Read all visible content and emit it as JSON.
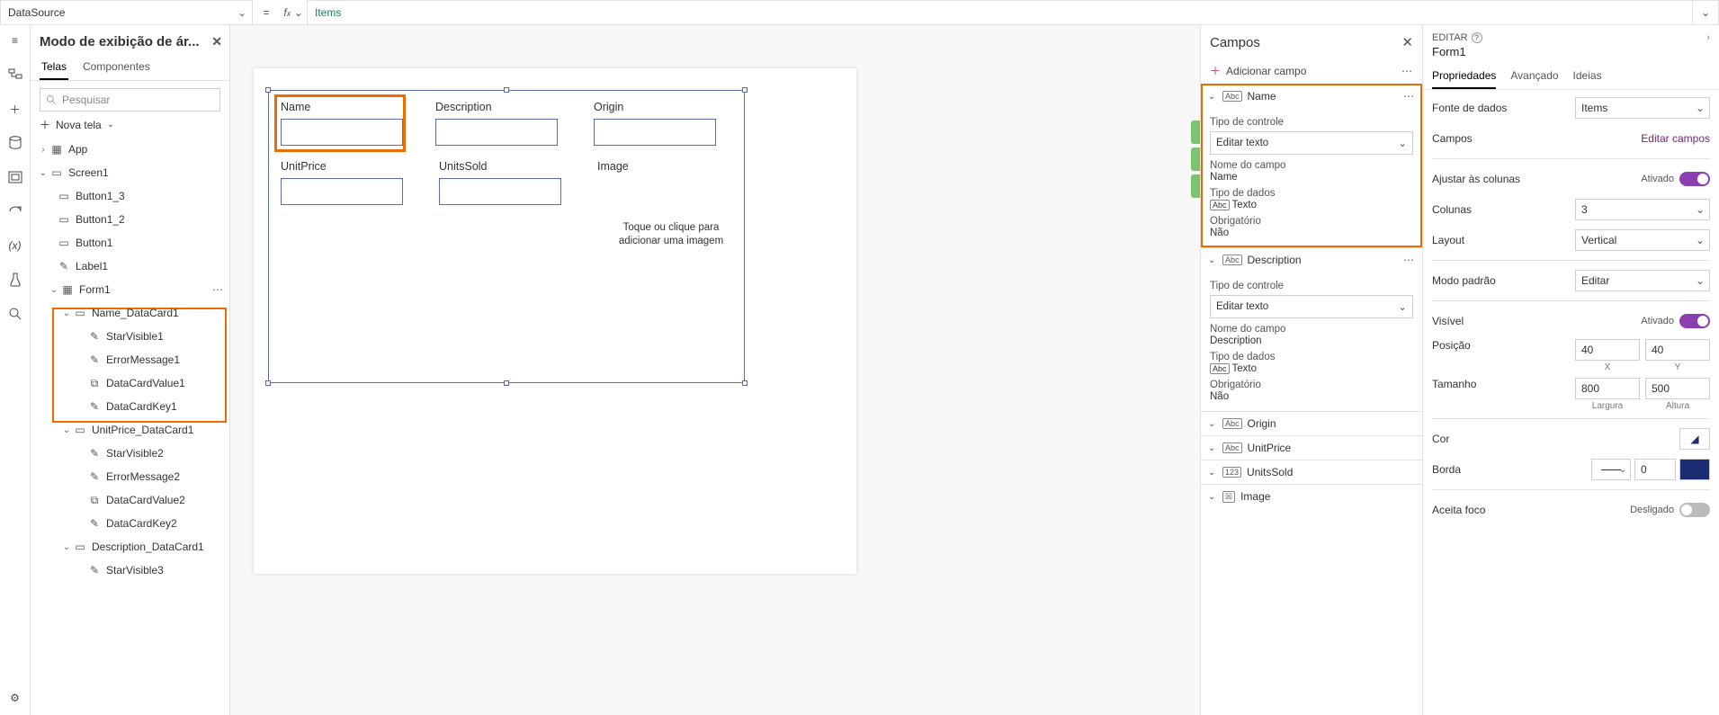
{
  "fx": {
    "property": "DataSource",
    "formula": "Items"
  },
  "tree": {
    "title": "Modo de exibição de ár...",
    "tabs": {
      "screens": "Telas",
      "components": "Componentes"
    },
    "search_placeholder": "Pesquisar",
    "new_screen": "Nova tela",
    "nodes": {
      "app": "App",
      "screen1": "Screen1",
      "button1_3": "Button1_3",
      "button1_2": "Button1_2",
      "button1": "Button1",
      "label1": "Label1",
      "form1": "Form1",
      "name_dc": "Name_DataCard1",
      "starvis1": "StarVisible1",
      "errmsg1": "ErrorMessage1",
      "dcval1": "DataCardValue1",
      "dckey1": "DataCardKey1",
      "unitprice_dc": "UnitPrice_DataCard1",
      "starvis2": "StarVisible2",
      "errmsg2": "ErrorMessage2",
      "dcval2": "DataCardValue2",
      "dckey2": "DataCardKey2",
      "desc_dc": "Description_DataCard1",
      "starvis3": "StarVisible3"
    }
  },
  "canvas": {
    "fields": {
      "name": "Name",
      "description": "Description",
      "origin": "Origin",
      "unitprice": "UnitPrice",
      "unitssold": "UnitsSold",
      "image": "Image"
    },
    "image_hint1": "Toque ou clique para",
    "image_hint2": "adicionar uma imagem"
  },
  "fields_pane": {
    "title": "Campos",
    "add": "Adicionar campo",
    "labels": {
      "control_type": "Tipo de controle",
      "edit_text": "Editar texto",
      "field_name": "Nome do campo",
      "data_type": "Tipo de dados",
      "texto": "Texto",
      "required": "Obrigatório",
      "no": "Não"
    },
    "items": {
      "name": "Name",
      "description": "Description",
      "origin": "Origin",
      "unitprice": "UnitPrice",
      "unitssold": "UnitsSold",
      "image": "Image",
      "desc_value": "Description"
    }
  },
  "props": {
    "edit": "EDITAR",
    "obj": "Form1",
    "tabs": {
      "props": "Propriedades",
      "adv": "Avançado",
      "ideas": "Ideias"
    },
    "datasource": "Fonte de dados",
    "datasource_val": "Items",
    "fields": "Campos",
    "edit_fields": "Editar campos",
    "snap": "Ajustar às colunas",
    "on": "Ativado",
    "columns": "Colunas",
    "columns_val": "3",
    "layout": "Layout",
    "layout_val": "Vertical",
    "defaultmode": "Modo padrão",
    "defaultmode_val": "Editar",
    "visible": "Visível",
    "position": "Posição",
    "x": "40",
    "y": "40",
    "xlab": "X",
    "ylab": "Y",
    "size": "Tamanho",
    "w": "800",
    "h": "500",
    "wlab": "Largura",
    "hlab": "Altura",
    "color": "Cor",
    "border": "Borda",
    "border_val": "0",
    "focus": "Aceita foco",
    "off": "Desligado"
  }
}
